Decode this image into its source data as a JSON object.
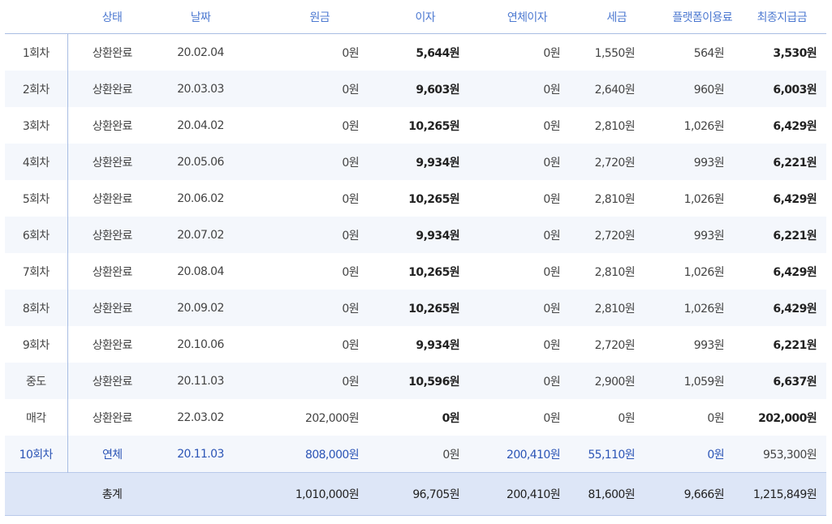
{
  "headers": [
    "",
    "상태",
    "날짜",
    "원금",
    "이자",
    "연체이자",
    "세금",
    "플랫폼이용료",
    "최종지급금"
  ],
  "rows": [
    {
      "label": "1회차",
      "status": "상환완료",
      "date": "20.02.04",
      "principal": "0원",
      "interest": "5,644원",
      "overdue_interest": "0원",
      "tax": "1,550원",
      "fee": "564원",
      "final": "3,530원"
    },
    {
      "label": "2회차",
      "status": "상환완료",
      "date": "20.03.03",
      "principal": "0원",
      "interest": "9,603원",
      "overdue_interest": "0원",
      "tax": "2,640원",
      "fee": "960원",
      "final": "6,003원"
    },
    {
      "label": "3회차",
      "status": "상환완료",
      "date": "20.04.02",
      "principal": "0원",
      "interest": "10,265원",
      "overdue_interest": "0원",
      "tax": "2,810원",
      "fee": "1,026원",
      "final": "6,429원"
    },
    {
      "label": "4회차",
      "status": "상환완료",
      "date": "20.05.06",
      "principal": "0원",
      "interest": "9,934원",
      "overdue_interest": "0원",
      "tax": "2,720원",
      "fee": "993원",
      "final": "6,221원"
    },
    {
      "label": "5회차",
      "status": "상환완료",
      "date": "20.06.02",
      "principal": "0원",
      "interest": "10,265원",
      "overdue_interest": "0원",
      "tax": "2,810원",
      "fee": "1,026원",
      "final": "6,429원"
    },
    {
      "label": "6회차",
      "status": "상환완료",
      "date": "20.07.02",
      "principal": "0원",
      "interest": "9,934원",
      "overdue_interest": "0원",
      "tax": "2,720원",
      "fee": "993원",
      "final": "6,221원"
    },
    {
      "label": "7회차",
      "status": "상환완료",
      "date": "20.08.04",
      "principal": "0원",
      "interest": "10,265원",
      "overdue_interest": "0원",
      "tax": "2,810원",
      "fee": "1,026원",
      "final": "6,429원"
    },
    {
      "label": "8회차",
      "status": "상환완료",
      "date": "20.09.02",
      "principal": "0원",
      "interest": "10,265원",
      "overdue_interest": "0원",
      "tax": "2,810원",
      "fee": "1,026원",
      "final": "6,429원"
    },
    {
      "label": "9회차",
      "status": "상환완료",
      "date": "20.10.06",
      "principal": "0원",
      "interest": "9,934원",
      "overdue_interest": "0원",
      "tax": "2,720원",
      "fee": "993원",
      "final": "6,221원"
    },
    {
      "label": "중도",
      "status": "상환완료",
      "date": "20.11.03",
      "principal": "0원",
      "interest": "10,596원",
      "overdue_interest": "0원",
      "tax": "2,900원",
      "fee": "1,059원",
      "final": "6,637원"
    },
    {
      "label": "매각",
      "status": "상환완료",
      "date": "22.03.02",
      "principal": "202,000원",
      "interest": "0원",
      "overdue_interest": "0원",
      "tax": "0원",
      "fee": "0원",
      "final": "202,000원"
    },
    {
      "label": "10회차",
      "status": "연체",
      "date": "20.11.03",
      "principal": "808,000원",
      "interest": "0원",
      "overdue_interest": "200,410원",
      "tax": "55,110원",
      "fee": "0원",
      "final": "953,300원"
    }
  ],
  "total": {
    "label": "총계",
    "principal": "1,010,000원",
    "interest": "96,705원",
    "overdue_interest": "200,410원",
    "tax": "81,600원",
    "fee": "9,666원",
    "final": "1,215,849원"
  },
  "colors": {
    "header_text": "#4e7ad1",
    "overdue_text": "#2c55b6",
    "row_alt_bg": "#f4f7fc",
    "total_bg": "#dde6f7",
    "divider": "#a8bde3"
  }
}
